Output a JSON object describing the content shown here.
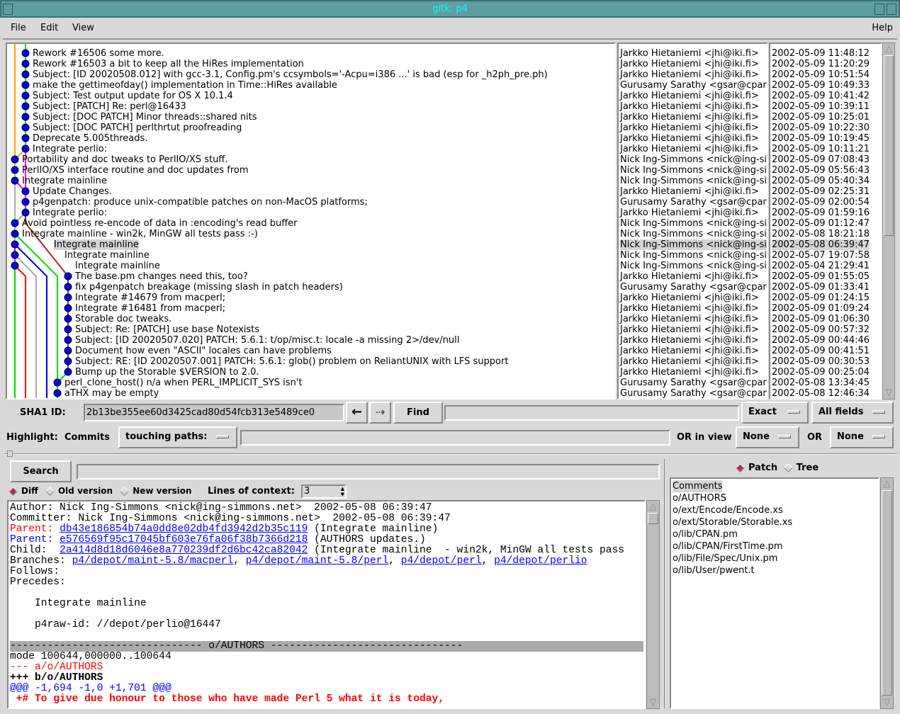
{
  "window": {
    "title": "gitk: p4"
  },
  "menu": {
    "file": "File",
    "edit": "Edit",
    "view": "View",
    "help": "Help"
  },
  "commits": [
    {
      "subject": "Rework #16506 some more.",
      "author": "Jarkko Hietaniemi <jhi@iki.fi>",
      "date": "2002-05-09 11:48:12",
      "col": 1
    },
    {
      "subject": "Rework #16503 a bit to keep all the HiRes implementation",
      "author": "Jarkko Hietaniemi <jhi@iki.fi>",
      "date": "2002-05-09 11:20:29",
      "col": 1
    },
    {
      "subject": "Subject: [ID 20020508.012] with gcc-3.1, Config.pm's ccsymbols='-Acpu=i386 ...' is bad (esp for _h2ph_pre.ph)",
      "author": "Jarkko Hietaniemi <jhi@iki.fi>",
      "date": "2002-05-09 10:51:54",
      "col": 1
    },
    {
      "subject": "make the gettimeofday() implementation in Time::HiRes available",
      "author": "Gurusamy Sarathy <gsar@cpan",
      "date": "2002-05-09 10:49:33",
      "col": 1
    },
    {
      "subject": "Subject: Test output update for OS X 10.1.4",
      "author": "Jarkko Hietaniemi <jhi@iki.fi>",
      "date": "2002-05-09 10:41:42",
      "col": 1
    },
    {
      "subject": "Subject: [PATCH] Re: perl@16433",
      "author": "Jarkko Hietaniemi <jhi@iki.fi>",
      "date": "2002-05-09 10:39:11",
      "col": 1
    },
    {
      "subject": "Subject: [DOC PATCH] Minor threads::shared nits",
      "author": "Jarkko Hietaniemi <jhi@iki.fi>",
      "date": "2002-05-09 10:25:01",
      "col": 1
    },
    {
      "subject": "Subject: [DOC PATCH] perlthrtut proofreading",
      "author": "Jarkko Hietaniemi <jhi@iki.fi>",
      "date": "2002-05-09 10:22:30",
      "col": 1
    },
    {
      "subject": "Deprecate 5.005threads.",
      "author": "Jarkko Hietaniemi <jhi@iki.fi>",
      "date": "2002-05-09 10:19:45",
      "col": 1
    },
    {
      "subject": "Integrate perlio:",
      "author": "Jarkko Hietaniemi <jhi@iki.fi>",
      "date": "2002-05-09 10:11:21",
      "col": 1
    },
    {
      "subject": "Portability and doc tweaks to PerlIO/XS stuff.",
      "author": "Nick Ing-Simmons <nick@ing-si",
      "date": "2002-05-09 07:08:43",
      "col": 0
    },
    {
      "subject": "PerlIO/XS interface routine and doc updates from",
      "author": "Nick Ing-Simmons <nick@ing-si",
      "date": "2002-05-09 05:56:43",
      "col": 0
    },
    {
      "subject": "Integrate mainline",
      "author": "Nick Ing-Simmons <nick@ing-si",
      "date": "2002-05-09 05:40:34",
      "col": 0
    },
    {
      "subject": "Update Changes.",
      "author": "Jarkko Hietaniemi <jhi@iki.fi>",
      "date": "2002-05-09 02:25:31",
      "col": 1
    },
    {
      "subject": "p4genpatch: produce unix-compatible patches on non-MacOS platforms;",
      "author": "Gurusamy Sarathy <gsar@cpan",
      "date": "2002-05-09 02:00:54",
      "col": 1
    },
    {
      "subject": "Integrate perlio:",
      "author": "Jarkko Hietaniemi <jhi@iki.fi>",
      "date": "2002-05-09 01:59:16",
      "col": 1
    },
    {
      "subject": "Avoid pointless re-encode of data in :encoding's read buffer",
      "author": "Nick Ing-Simmons <nick@ing-si",
      "date": "2002-05-09 01:12:47",
      "col": 0
    },
    {
      "subject": "Integrate mainline  - win2k, MinGW all tests pass :-)",
      "author": "Nick Ing-Simmons <nick@ing-si",
      "date": "2002-05-08 18:21:18",
      "col": 0
    },
    {
      "subject": "Integrate mainline",
      "author": "Nick Ing-Simmons <nick@ing-si",
      "date": "2002-05-08 06:39:47",
      "col": 0,
      "textcol": 3,
      "selected": true
    },
    {
      "subject": "Integrate mainline",
      "author": "Nick Ing-Simmons <nick@ing-si",
      "date": "2002-05-07 19:07:58",
      "col": 0,
      "textcol": 4
    },
    {
      "subject": "Integrate mainline",
      "author": "Nick Ing-Simmons <nick@ing-si",
      "date": "2002-05-04 21:29:41",
      "col": 0,
      "textcol": 5
    },
    {
      "subject": "The base.pm changes need this, too?",
      "author": "Jarkko Hietaniemi <jhi@iki.fi>",
      "date": "2002-05-09 01:55:05",
      "col": 5
    },
    {
      "subject": "fix p4genpatch breakage (missing slash in patch headers)",
      "author": "Gurusamy Sarathy <gsar@cpan",
      "date": "2002-05-09 01:33:41",
      "col": 5
    },
    {
      "subject": "Integrate #14679 from macperl;",
      "author": "Jarkko Hietaniemi <jhi@iki.fi>",
      "date": "2002-05-09 01:24:15",
      "col": 5
    },
    {
      "subject": "Integrate #16481 from macperl;",
      "author": "Jarkko Hietaniemi <jhi@iki.fi>",
      "date": "2002-05-09 01:09:24",
      "col": 5
    },
    {
      "subject": "Storable doc tweaks.",
      "author": "Jarkko Hietaniemi <jhi@iki.fi>",
      "date": "2002-05-09 01:06:30",
      "col": 5
    },
    {
      "subject": "Subject: Re: [PATCH] use base Notexists",
      "author": "Jarkko Hietaniemi <jhi@iki.fi>",
      "date": "2002-05-09 00:57:32",
      "col": 5
    },
    {
      "subject": "Subject: [ID 20020507.020] PATCH: 5.6.1: t/op/misc.t: locale -a missing 2>/dev/null",
      "author": "Jarkko Hietaniemi <jhi@iki.fi>",
      "date": "2002-05-09 00:44:46",
      "col": 5
    },
    {
      "subject": "Document how even \"ASCII\" locales can have problems",
      "author": "Jarkko Hietaniemi <jhi@iki.fi>",
      "date": "2002-05-09 00:41:51",
      "col": 5
    },
    {
      "subject": "Subject: RE: [ID 20020507.001] PATCH: 5.6.1: glob() problem on ReliantUNIX with LFS support",
      "author": "Jarkko Hietaniemi <jhi@iki.fi>",
      "date": "2002-05-09 00:30:53",
      "col": 5
    },
    {
      "subject": "Bump up the Storable $VERSION to 2.0.",
      "author": "Jarkko Hietaniemi <jhi@iki.fi>",
      "date": "2002-05-09 00:25:04",
      "col": 5
    },
    {
      "subject": "perl_clone_host() n/a when PERL_IMPLICIT_SYS isn't",
      "author": "Gurusamy Sarathy <gsar@cpan",
      "date": "2002-05-08 13:34:45",
      "col": 4
    },
    {
      "subject": "aTHX may be empty",
      "author": "Gurusamy Sarathy <gsar@cpan",
      "date": "2002-05-08 12:46:34",
      "col": 4
    }
  ],
  "colors": {
    "node": "#0000ff",
    "selection": "#d4d4d4",
    "titlebar": "#5f9ea0",
    "title_text": "#00ffff",
    "parent1": "#ff0000",
    "parent2": "#0000ff",
    "diff_removed": "#ff0000",
    "diff_hunk": "#0000ff",
    "diff_header_bg": "#aaaaaa"
  },
  "toolbar": {
    "sha1_label": "SHA1 ID:",
    "sha1_value": "2b13be355ee60d3425cad80d54fcb313e5489ce0",
    "back_icon": "arrow-left-icon",
    "forward_icon": "arrow-right-icon",
    "find_label": "Find",
    "find_value": "",
    "find_type": "Exact",
    "find_fields": "All fields"
  },
  "highlight": {
    "label": "Highlight:",
    "commits_label": "Commits",
    "mode": "touching paths:",
    "paths_value": "",
    "or_in_view_label": "OR in view",
    "view_value": "None",
    "or_label": "OR",
    "or_value": "None"
  },
  "search": {
    "button": "Search",
    "value": "",
    "diff_label": "Diff",
    "old_label": "Old version",
    "new_label": "New version",
    "selected": "Diff",
    "context_label": "Lines of context:",
    "context_value": "3"
  },
  "details": {
    "author": "Author: Nick Ing-Simmons <nick@ing-simmons.net>  2002-05-08 06:39:47",
    "committer": "Committer: Nick Ing-Simmons <nick@ing-simmons.net>  2002-05-08 06:39:47",
    "parent_label": "Parent: ",
    "parent1_sha": "db43e186854b74a0dd8e02db4fd3942d2b35c119",
    "parent1_desc": " (Integrate mainline)",
    "parent2_sha": "e576569f95c17045bf603e76fa06f38b7366d218",
    "parent2_desc": " (AUTHORS updates.)",
    "child_label": "Child:  ",
    "child_sha": "2a414d8d18d6046e8a770239df2d6bc42ca82042",
    "child_desc": " (Integrate mainline  - win2k, MinGW all tests pass",
    "branches_label": "Branches: ",
    "branches": [
      "p4/depot/maint-5.8/macperl",
      "p4/depot/maint-5.8/perl",
      "p4/depot/perl",
      "p4/depot/perlio"
    ],
    "follows": "Follows:",
    "precedes": "Precedes:",
    "message": "    Integrate mainline",
    "rawid": "    p4raw-id: //depot/perlio@16447",
    "file_header": "------------------------------- o/AUTHORS -------------------------------",
    "mode": "mode 100644,000000..100644",
    "minus": "--- a/o/AUTHORS",
    "plus": "+++ b/o/AUTHORS",
    "hunk": "@@@ -1,694 -1,0 +1,701 @@@",
    "added": " +# To give due honour to those who have made Perl 5 what it is today,"
  },
  "filelist": {
    "patch_label": "Patch",
    "tree_label": "Tree",
    "selected": "Patch",
    "items": [
      "Comments",
      "o/AUTHORS",
      "o/ext/Encode/Encode.xs",
      "o/ext/Storable/Storable.xs",
      "o/lib/CPAN.pm",
      "o/lib/CPAN/FirstTime.pm",
      "o/lib/File/Spec/Unix.pm",
      "o/lib/User/pwent.t"
    ]
  }
}
